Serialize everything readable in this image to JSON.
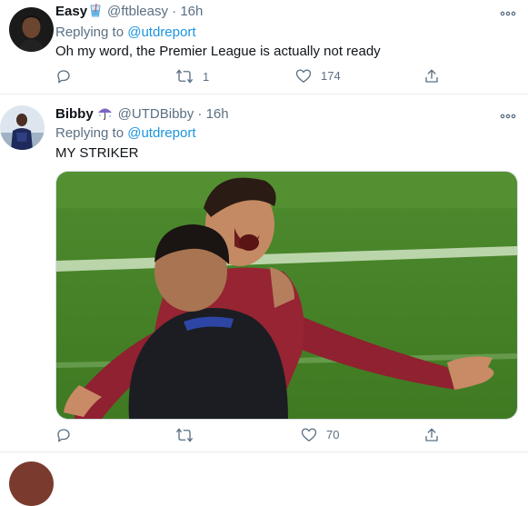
{
  "tweets": [
    {
      "display_name": "Easy",
      "handle": "@ftbleasy",
      "time": "16h",
      "reply_prefix": "Replying to",
      "reply_to": "@utdreport",
      "text": "Oh my word, the Premier League is actually not ready",
      "retweets": "1",
      "likes": "174"
    },
    {
      "display_name": "Bibby",
      "handle": "@UTDBibby",
      "time": "16h",
      "reply_prefix": "Replying to",
      "reply_to": "@utdreport",
      "text": "MY STRIKER",
      "retweets": "",
      "likes": "70"
    }
  ],
  "separator": "·",
  "icons": {
    "more": "more-horizontal-icon",
    "reply": "reply-icon",
    "retweet": "retweet-icon",
    "like": "heart-icon",
    "share": "share-icon",
    "emoji1": "glass-emoji-icon",
    "emoji2": "umbrella-emoji-icon"
  },
  "colors": {
    "text": "#0f1419",
    "muted": "#5b7083",
    "link": "#1b95e0",
    "border": "#e6ecf0"
  }
}
